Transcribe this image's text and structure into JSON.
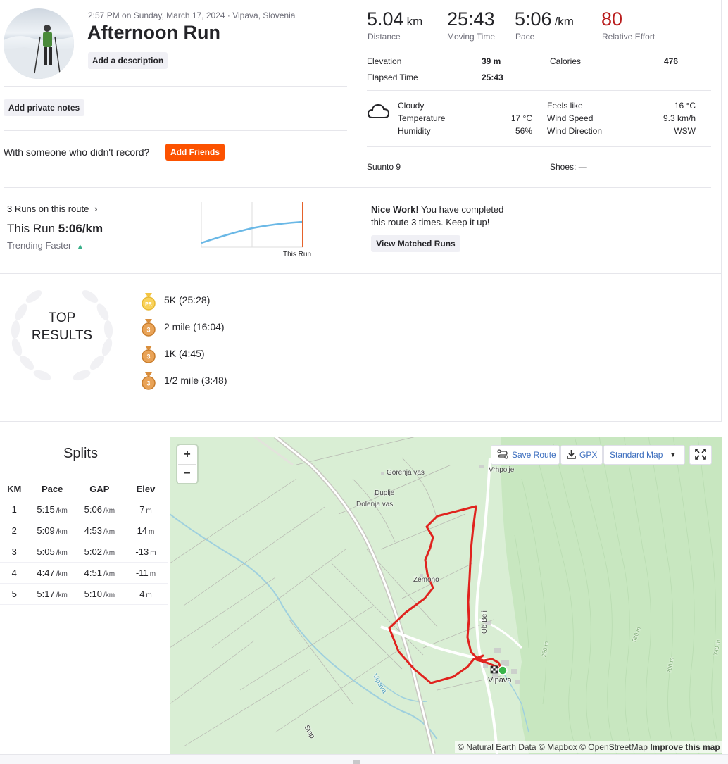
{
  "activity": {
    "meta": "2:57 PM on Sunday, March 17, 2024 · Vipava, Slovenia",
    "title": "Afternoon Run",
    "add_description": "Add a description",
    "add_private_notes": "Add private notes",
    "with_someone": "With someone who didn't record?",
    "add_friends": "Add Friends"
  },
  "stats": {
    "distance": {
      "value": "5.04",
      "unit": "km",
      "label": "Distance"
    },
    "moving_time": {
      "value": "25:43",
      "label": "Moving Time"
    },
    "pace": {
      "value": "5:06",
      "unit": "/km",
      "label": "Pace"
    },
    "relative_effort": {
      "value": "80",
      "label": "Relative Effort",
      "color": "#b91c1c"
    },
    "elevation": {
      "label": "Elevation",
      "value": "39 m"
    },
    "calories": {
      "label": "Calories",
      "value": "476"
    },
    "elapsed_time": {
      "label": "Elapsed Time",
      "value": "25:43"
    }
  },
  "weather": {
    "icon": "cloud-icon",
    "condition": "Cloudy",
    "temperature": {
      "label": "Temperature",
      "value": "17 °C"
    },
    "humidity": {
      "label": "Humidity",
      "value": "56%"
    },
    "feels_like": {
      "label": "Feels like",
      "value": "16 °C"
    },
    "wind_speed": {
      "label": "Wind Speed",
      "value": "9.3 km/h"
    },
    "wind_direction": {
      "label": "Wind Direction",
      "value": "WSW"
    }
  },
  "gear": {
    "device": "Suunto 9",
    "shoes": "Shoes: —"
  },
  "route": {
    "runs_on_route": "3 Runs on this route",
    "this_run_label": "This Run",
    "this_run_pace": "5:06/km",
    "trend": "Trending Faster",
    "chart_label": "This Run",
    "nice_work_bold": "Nice Work!",
    "nice_work_line1": " You have completed",
    "nice_work_line2": "this route 3 times. Keep it up!",
    "view_matched": "View Matched Runs"
  },
  "top_results": {
    "title_line1": "TOP",
    "title_line2": "RESULTS",
    "items": [
      {
        "medal": "PR",
        "text": "5K (25:28)"
      },
      {
        "medal": "3",
        "text": "2 mile (16:04)"
      },
      {
        "medal": "3",
        "text": "1K (4:45)"
      },
      {
        "medal": "3",
        "text": "1/2 mile (3:48)"
      }
    ]
  },
  "splits": {
    "title": "Splits",
    "headers": [
      "KM",
      "Pace",
      "GAP",
      "Elev"
    ],
    "pace_unit": "/km",
    "elev_unit": "m",
    "rows": [
      {
        "km": "1",
        "pace": "5:15",
        "gap": "5:06",
        "elev": "7"
      },
      {
        "km": "2",
        "pace": "5:09",
        "gap": "4:53",
        "elev": "14"
      },
      {
        "km": "3",
        "pace": "5:05",
        "gap": "5:02",
        "elev": "-13"
      },
      {
        "km": "4",
        "pace": "4:47",
        "gap": "4:51",
        "elev": "-11"
      },
      {
        "km": "5",
        "pace": "5:17",
        "gap": "5:10",
        "elev": "4"
      }
    ]
  },
  "map": {
    "zoom_in": "+",
    "zoom_out": "−",
    "save_route": "Save Route",
    "gpx": "GPX",
    "map_style": "Standard Map",
    "attribution": "© Natural Earth Data © Mapbox © OpenStreetMap",
    "improve": "Improve this map",
    "places": {
      "gorenja_vas": "Gorenja vas",
      "vrhpolje": "Vrhpolje",
      "duplje": "Duplje",
      "dolenja_vas": "Dolenja vas",
      "zemono": "Zemono",
      "vipava": "Vipava",
      "ob_beli": "Ob Beli",
      "river": "Vipava",
      "slap": "Slap",
      "c220": "220 m",
      "c580": "580 m",
      "c700": "700 m",
      "c740": "740 m"
    }
  }
}
